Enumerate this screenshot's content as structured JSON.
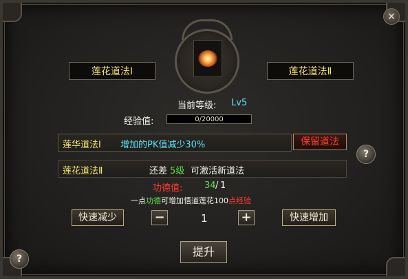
{
  "tabs": {
    "left": "莲花道法Ⅰ",
    "right": "莲花道法Ⅱ"
  },
  "level": {
    "label": "当前等级:",
    "value": "Lv5"
  },
  "exp": {
    "label": "经验值:",
    "value": "0/20000"
  },
  "skill1": {
    "name": "莲华道法Ⅰ",
    "effect": "增加的PK值减少30%"
  },
  "keep_button": "保留道法",
  "skill2": {
    "name": "莲花道法Ⅱ",
    "need_prefix": "还差",
    "need_value": "5级",
    "need_suffix": "可激活新道法"
  },
  "merit": {
    "label": "功德值:",
    "current": "34",
    "sep": "/",
    "need": "1"
  },
  "hint": {
    "p1": "一点",
    "p2": "功德",
    "p3": "可增加悟道莲花",
    "p4": "100",
    "p5": "点经验"
  },
  "controls": {
    "fast_decrease": "快速减少",
    "minus": "−",
    "quantity": "1",
    "plus": "+",
    "fast_increase": "快速增加"
  },
  "upgrade_button": "提升",
  "help_glyph": "?",
  "close_glyph": "×",
  "colors": {
    "yellow": "#f3e36a",
    "cyan": "#58e2f4",
    "red": "#ff3a2a",
    "green": "#5be04a"
  }
}
